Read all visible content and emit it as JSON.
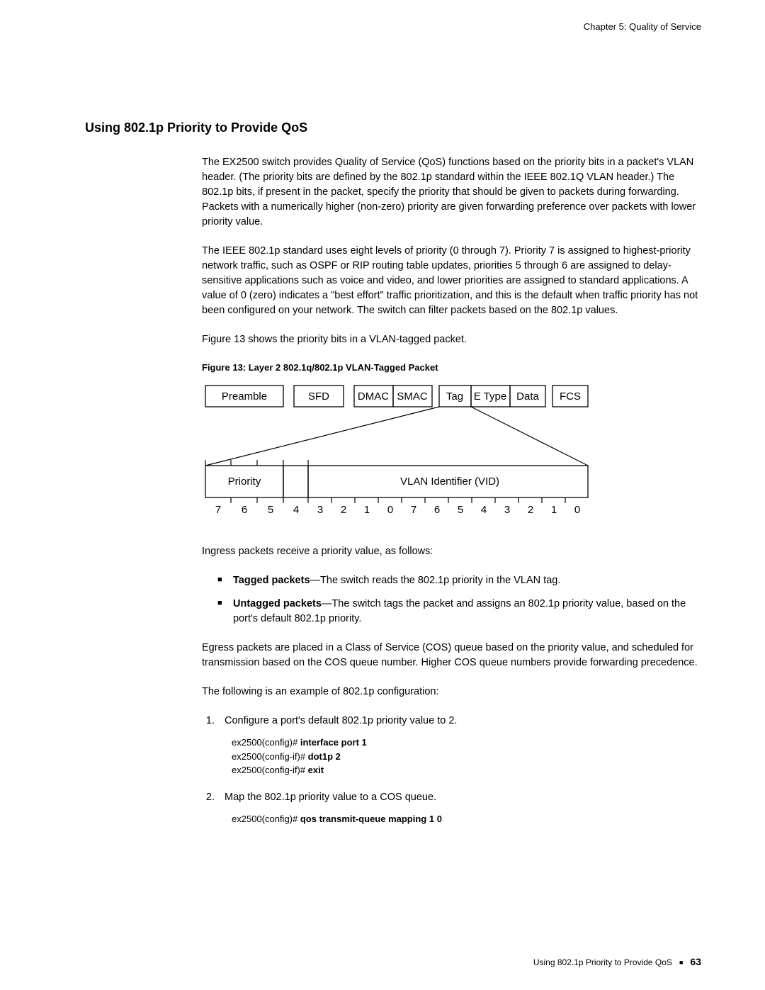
{
  "chapter_header": "Chapter 5: Quality of Service",
  "section_heading": "Using 802.1p Priority to Provide QoS",
  "p1": "The EX2500 switch provides Quality of Service (QoS) functions based on the priority bits in a packet's VLAN header. (The priority bits are defined by the 802.1p standard within the IEEE 802.1Q VLAN header.) The 802.1p bits, if present in the packet, specify the priority that should be given to packets during forwarding. Packets with a numerically higher (non-zero) priority are given forwarding preference over packets with lower priority value.",
  "p2": "The IEEE 802.1p standard uses eight levels of priority (0 through 7). Priority 7 is assigned to highest-priority network traffic, such as OSPF or RIP routing table updates, priorities 5 through 6 are assigned to delay-sensitive applications such as voice and video, and lower priorities are assigned to standard applications. A value of 0 (zero) indicates a \"best effort\" traffic prioritization, and this is the default when traffic priority has not been configured on your network. The switch can filter packets based on the 802.1p values.",
  "p3": "Figure 13 shows the priority bits in a VLAN-tagged packet.",
  "figure_caption": "Figure 13:  Layer 2 802.1q/802.1p VLAN-Tagged Packet",
  "figure": {
    "top": [
      "Preamble",
      "SFD",
      "DMAC",
      "SMAC",
      "Tag",
      "E Type",
      "Data",
      "FCS"
    ],
    "bottom_left": "Priority",
    "bottom_right": "VLAN Identifier (VID)",
    "bits": [
      "7",
      "6",
      "5",
      "4",
      "3",
      "2",
      "1",
      "0",
      "7",
      "6",
      "5",
      "4",
      "3",
      "2",
      "1",
      "0"
    ]
  },
  "p4": "Ingress packets receive a priority value, as follows:",
  "bullets": [
    {
      "b": "Tagged packets",
      "rest": "—The switch reads the 802.1p priority in the VLAN tag."
    },
    {
      "b": "Untagged packets",
      "rest": "—The switch tags the packet and assigns an 802.1p priority value, based on the port's default 802.1p priority."
    }
  ],
  "p5": "Egress packets are placed in a Class of Service (COS) queue based on the priority value, and scheduled for transmission based on the COS queue number. Higher COS queue numbers provide forwarding precedence.",
  "p6": "The following is an example of 802.1p configuration:",
  "steps": [
    {
      "text": "Configure a port's default 802.1p priority value to 2.",
      "code": [
        {
          "pre": "ex2500(config)# ",
          "cmd": "interface port 1"
        },
        {
          "pre": "ex2500(config-if)# ",
          "cmd": "dot1p 2"
        },
        {
          "pre": "ex2500(config-if)# ",
          "cmd": "exit"
        }
      ]
    },
    {
      "text": "Map the 802.1p priority value to a COS queue.",
      "code": [
        {
          "pre": "ex2500(config)# ",
          "cmd": "qos transmit-queue mapping 1 0"
        }
      ]
    }
  ],
  "footer_text": "Using 802.1p Priority to Provide QoS",
  "page_number": "63"
}
